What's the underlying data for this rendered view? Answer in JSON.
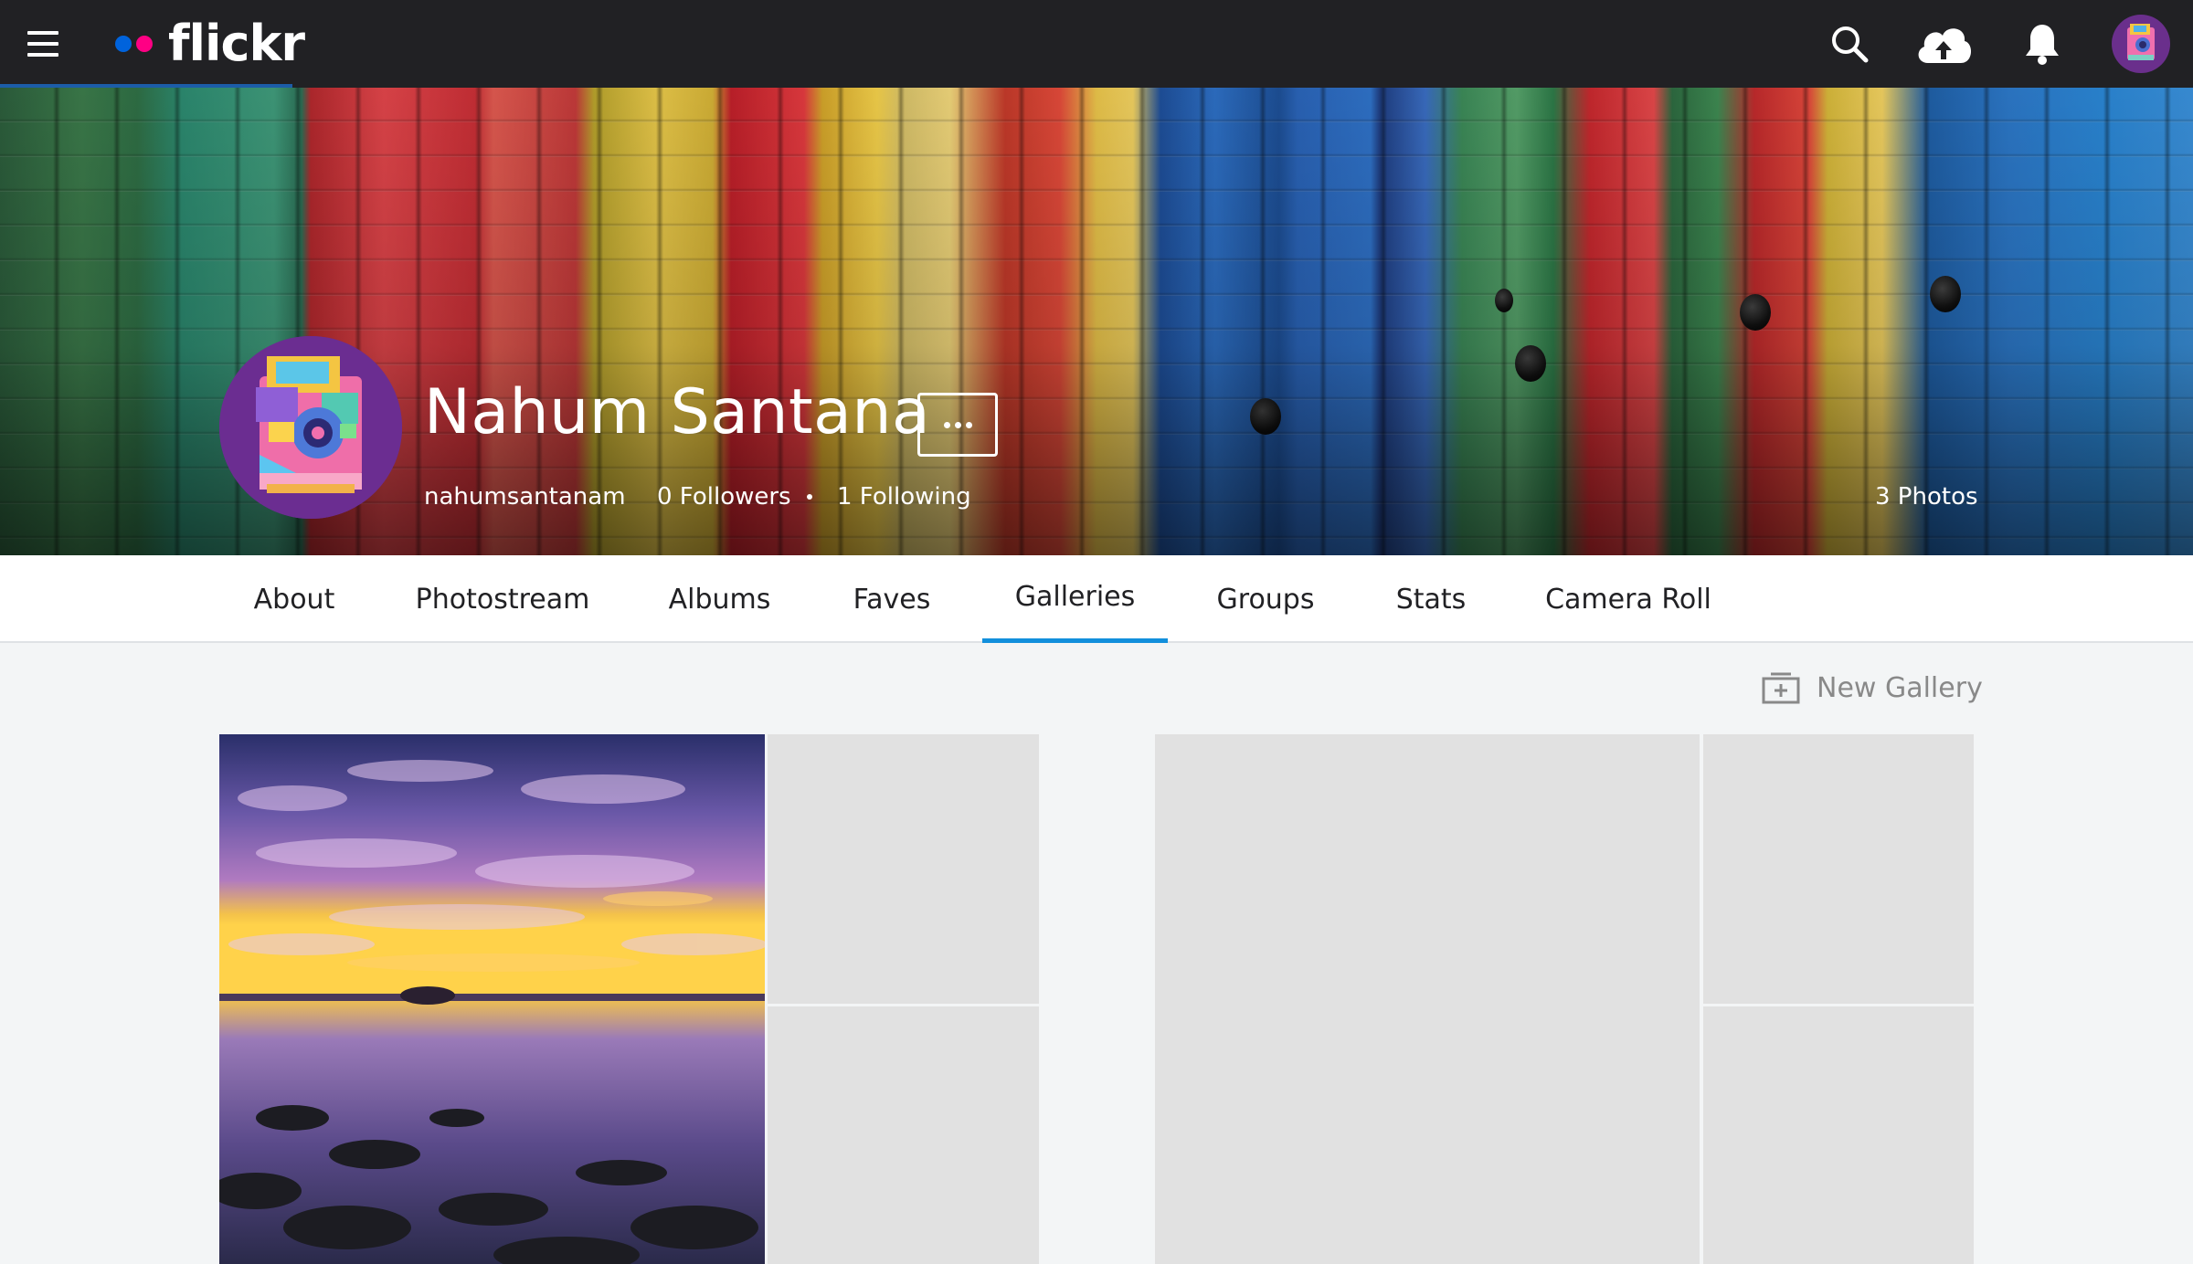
{
  "header": {
    "logo_text": "flickr",
    "logo_dot_colors": [
      "#0063dc",
      "#ff0084"
    ],
    "icons": [
      "menu-icon",
      "search-icon",
      "upload-cloud-icon",
      "bell-icon",
      "avatar"
    ]
  },
  "profile": {
    "name": "Nahum Santana",
    "username": "nahumsantanam",
    "followers": "0 Followers",
    "following": "1 Following",
    "photos": "3 Photos"
  },
  "tabs": [
    {
      "label": "About"
    },
    {
      "label": "Photostream"
    },
    {
      "label": "Albums"
    },
    {
      "label": "Faves"
    },
    {
      "label": "Galleries",
      "active": true
    },
    {
      "label": "Groups"
    },
    {
      "label": "Stats"
    },
    {
      "label": "Camera Roll"
    }
  ],
  "actions": {
    "new_gallery": "New Gallery"
  },
  "colors": {
    "topbar": "#212124",
    "active_tab": "#128fdc",
    "placeholder": "#e1e1e1",
    "avatar_bg": "#6b2d91"
  }
}
